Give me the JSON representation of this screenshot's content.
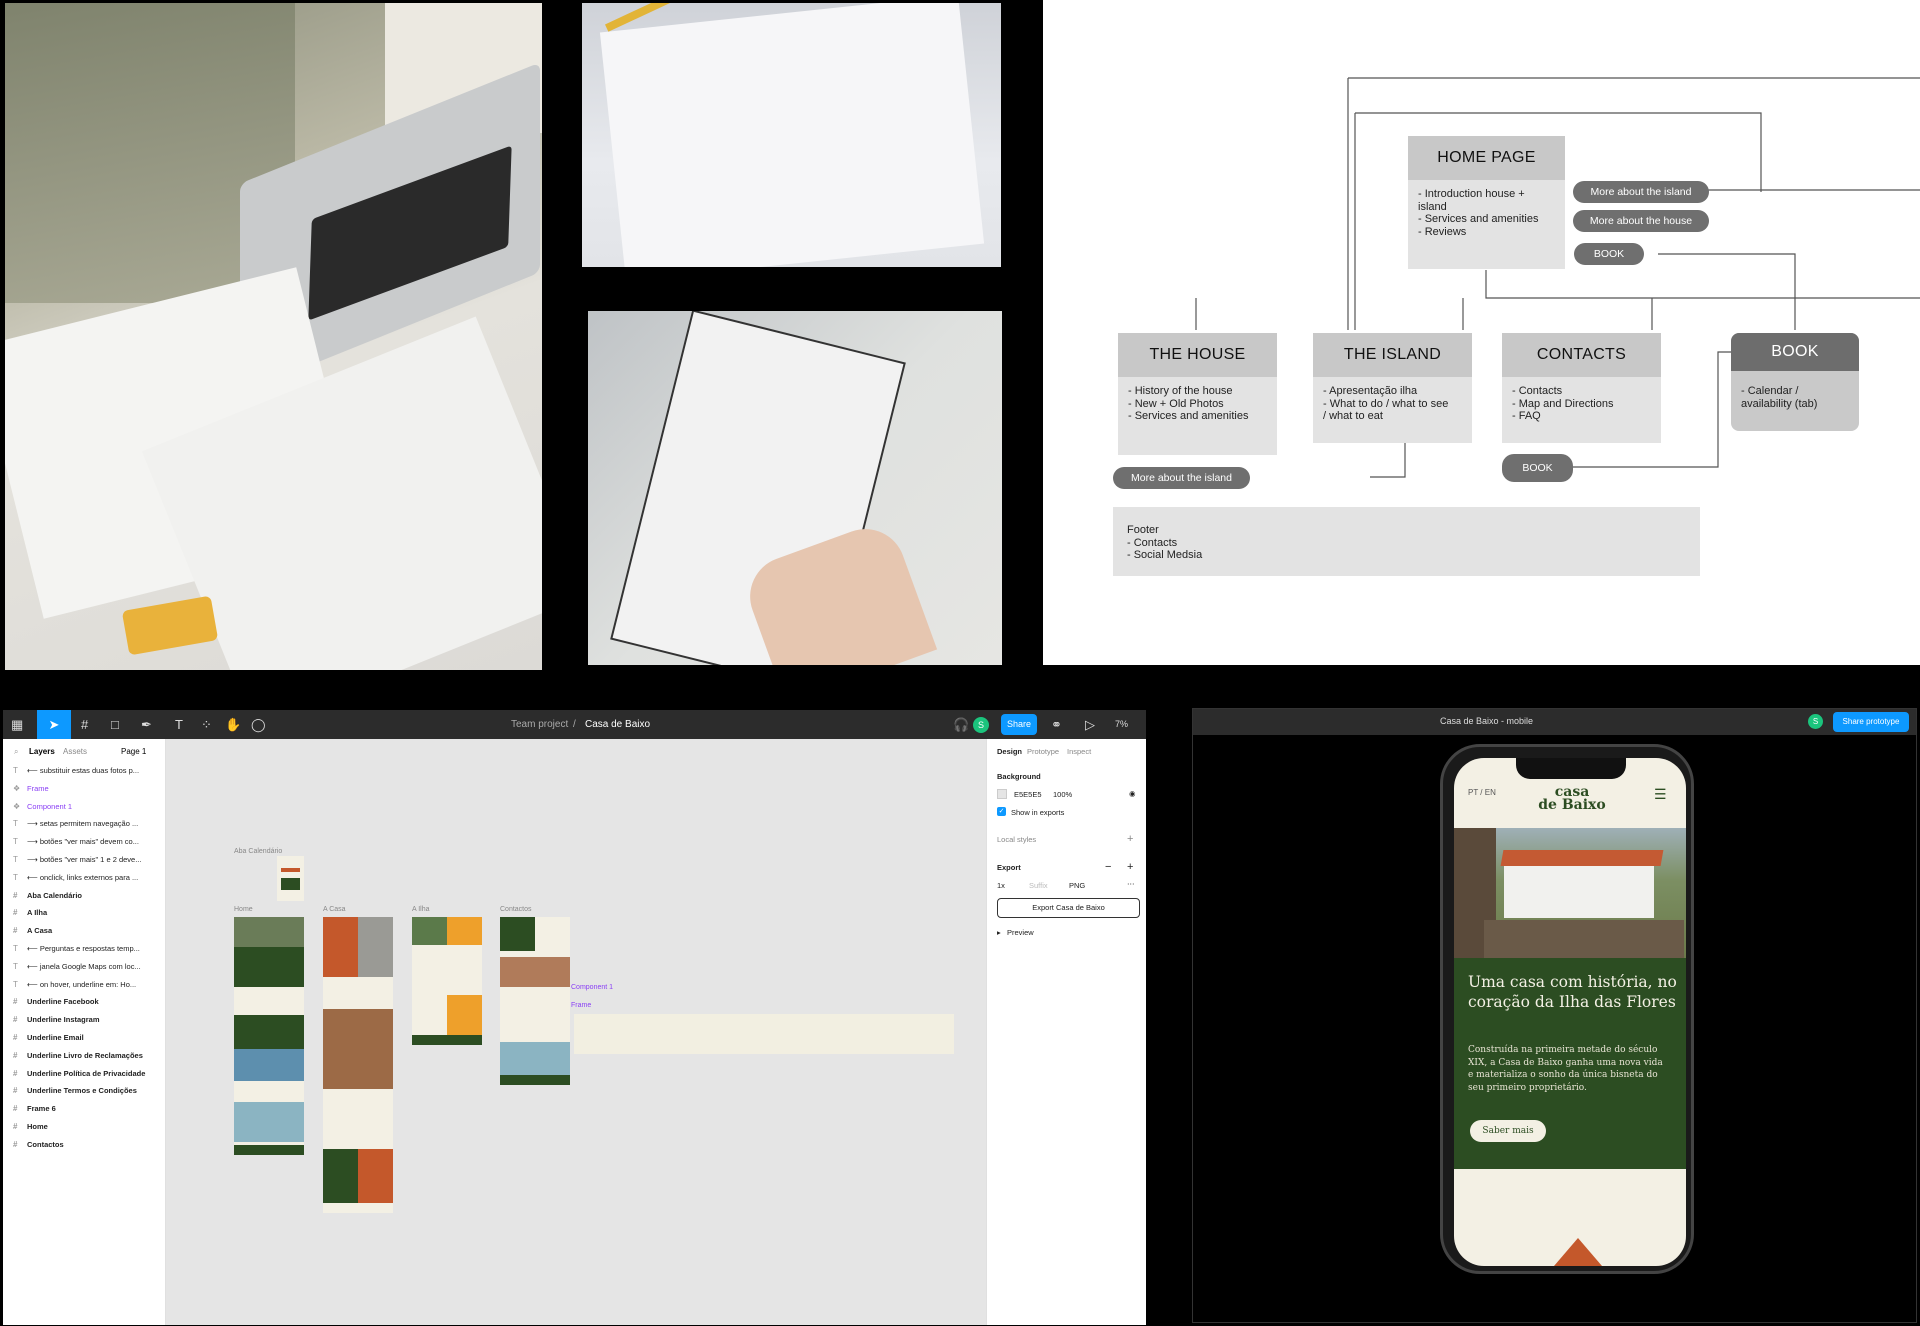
{
  "sitemap": {
    "home": {
      "title": "HOME PAGE",
      "body": "- Introduction house +\n  island\n- Services and amenities\n- Reviews"
    },
    "home_pills": [
      "More about the island",
      "More about the house",
      "BOOK"
    ],
    "house": {
      "title": "THE HOUSE",
      "body": "- History of the house\n- New + Old Photos\n- Services and amenities"
    },
    "island": {
      "title": "THE ISLAND",
      "body": "- Apresentação ilha\n- What to do / what to see\n/ what to eat"
    },
    "contacts": {
      "title": "CONTACTS",
      "body": "- Contacts\n- Map and Directions\n- FAQ"
    },
    "book": {
      "title": "BOOK",
      "body": "- Calendar /\n  availability (tab)"
    },
    "house_pill": "More about the island",
    "contacts_pill": "BOOK",
    "footer": "Footer\n- Contacts\n- Social Medsia"
  },
  "figma": {
    "breadcrumb_team": "Team project",
    "breadcrumb_sep": "/",
    "file_name": "Casa de Baixo",
    "share_label": "Share",
    "zoom": "7%",
    "avatar": "S",
    "tabs": {
      "layers": "Layers",
      "assets": "Assets",
      "page": "Page 1"
    },
    "layers": [
      {
        "name": "⟵ substituir estas duas fotos p...",
        "type": "text"
      },
      {
        "name": "Frame",
        "type": "component"
      },
      {
        "name": "Component 1",
        "type": "component"
      },
      {
        "name": "⟶ setas permitem navegação ...",
        "type": "text"
      },
      {
        "name": "⟶ botões \"ver mais\" devem co...",
        "type": "text"
      },
      {
        "name": "⟶ botões \"ver mais\" 1 e 2 deve...",
        "type": "text"
      },
      {
        "name": "⟵ onclick, links externos para ...",
        "type": "text"
      },
      {
        "name": "Aba Calendário",
        "type": "frame"
      },
      {
        "name": "A Ilha",
        "type": "frame"
      },
      {
        "name": "A Casa",
        "type": "frame"
      },
      {
        "name": "⟵ Perguntas e respostas temp...",
        "type": "text"
      },
      {
        "name": "⟵ janela Google Maps com loc...",
        "type": "text"
      },
      {
        "name": "⟵ on hover, underline em: Ho...",
        "type": "text"
      },
      {
        "name": "Underline Facebook",
        "type": "frame"
      },
      {
        "name": "Underline Instagram",
        "type": "frame"
      },
      {
        "name": "Underline Email",
        "type": "frame"
      },
      {
        "name": "Underline Livro de Reclamações",
        "type": "frame"
      },
      {
        "name": "Underline Política de Privacidade",
        "type": "frame"
      },
      {
        "name": "Underline Termos e Condições",
        "type": "frame"
      },
      {
        "name": "Frame 6",
        "type": "frame"
      },
      {
        "name": "Home",
        "type": "frame"
      },
      {
        "name": "Contactos",
        "type": "frame"
      }
    ],
    "right_panel": {
      "tabs": [
        "Design",
        "Prototype",
        "Inspect"
      ],
      "background_label": "Background",
      "bg_hex": "E5E5E5",
      "bg_opacity": "100%",
      "show_in_exports": "Show in exports",
      "local_styles": "Local styles",
      "export_label": "Export",
      "export_scale": "1x",
      "export_suffix": "Suffix",
      "export_format": "PNG",
      "export_button": "Export Casa de Baixo",
      "preview": "Preview"
    },
    "canvas_labels": {
      "calendar": "Aba Calendário",
      "home": "Home",
      "casa": "A Casa",
      "ilha": "A Ilha",
      "contactos": "Contactos",
      "component": "Component 1",
      "frame": "Frame"
    }
  },
  "prototype": {
    "title": "Casa de Baixo - mobile",
    "share_label": "Share prototype",
    "avatar": "S",
    "lang": "PT / EN",
    "logo": "casa\nde Baixo",
    "headline": "Uma casa com história, no coração da Ilha das Flores",
    "body": "Construída na primeira metade do século XIX, a Casa de Baixo ganha uma nova vida e materializa o sonho da única bisneta do seu primeiro proprietário.",
    "cta": "Saber mais"
  },
  "colors": {
    "dark_green": "#2c4d22",
    "cream": "#f3f0e4",
    "terracotta": "#c4582b",
    "figma_blue": "#0d99ff",
    "figma_purple": "#8a3ff5"
  }
}
